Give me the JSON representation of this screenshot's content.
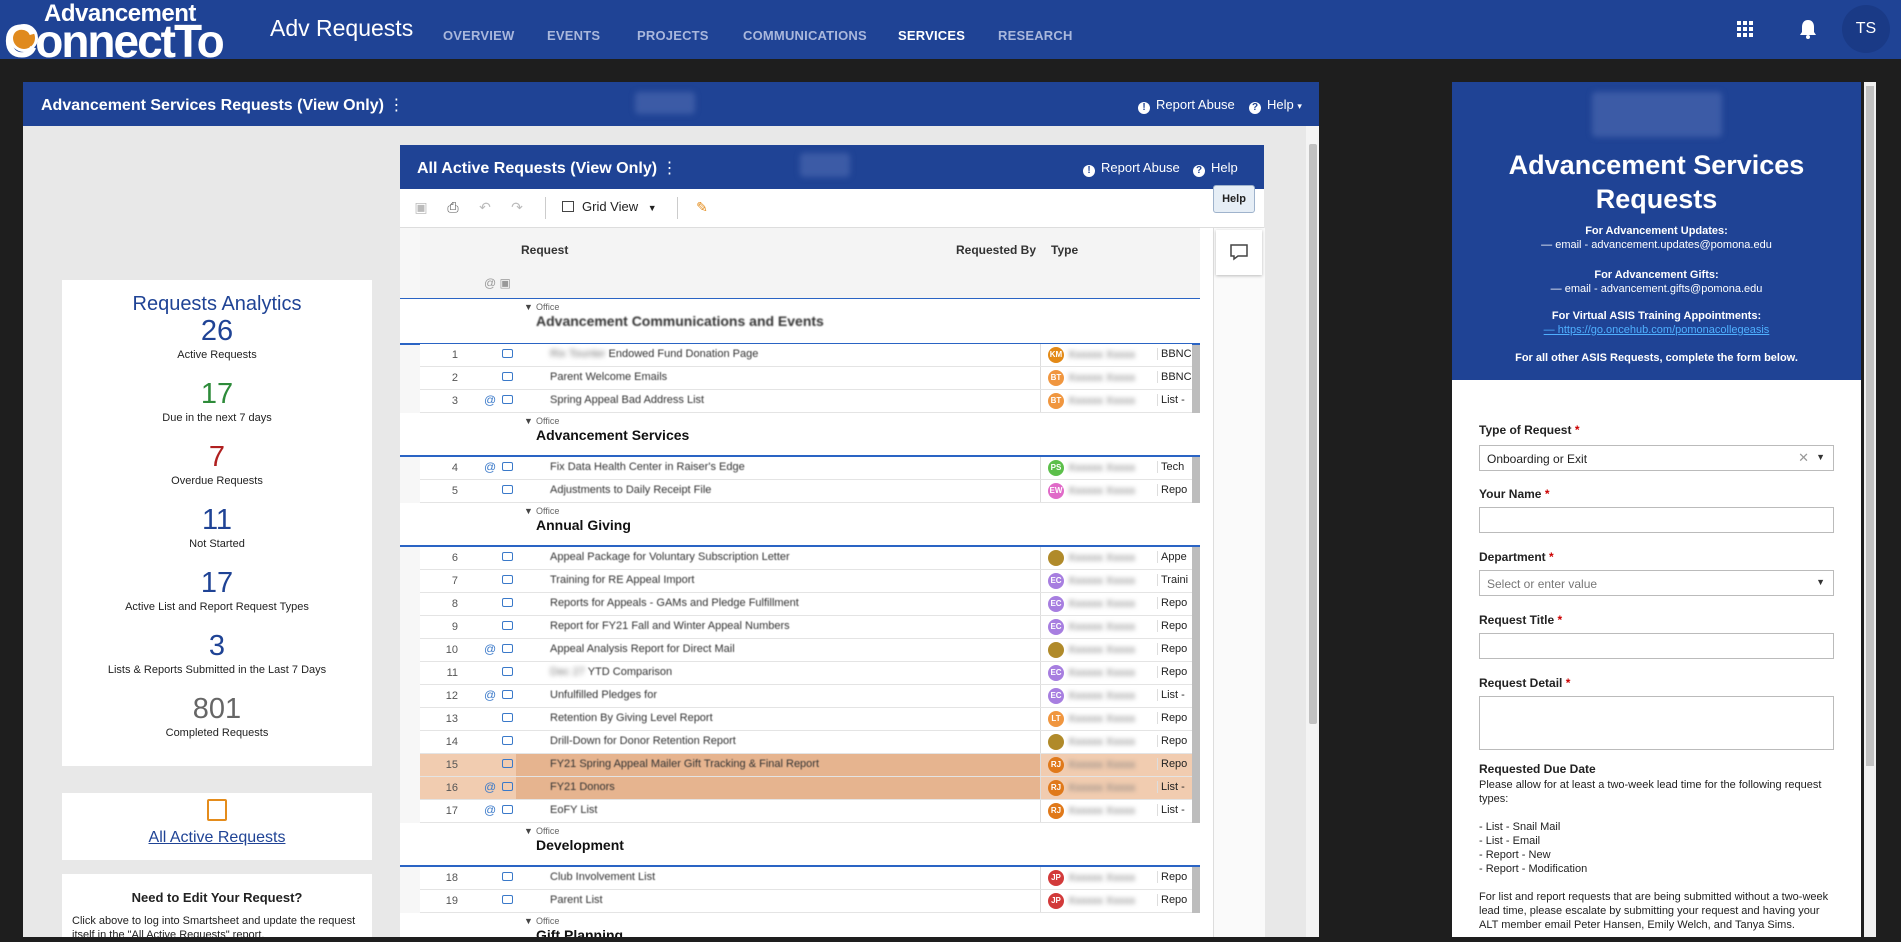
{
  "topbar": {
    "logo_line1": "Advancement",
    "logo_line2": "ConnectTo",
    "app_title": "Adv Requests",
    "nav": [
      "OVERVIEW",
      "EVENTS",
      "PROJECTS",
      "COMMUNICATIONS",
      "SERVICES",
      "RESEARCH"
    ],
    "active_nav": "SERVICES",
    "user_initials": "TS"
  },
  "left_panel": {
    "title": "Advancement Services Requests (View Only)",
    "report_abuse": "Report Abuse",
    "help": "Help"
  },
  "analytics": {
    "title": "Requests Analytics",
    "stats": [
      {
        "value": "26",
        "label": "Active Requests",
        "color": "#1f4395"
      },
      {
        "value": "17",
        "label": "Due in the next 7 days",
        "color": "#2e8b3a"
      },
      {
        "value": "7",
        "label": "Overdue Requests",
        "color": "#b02020"
      },
      {
        "value": "11",
        "label": "Not Started",
        "color": "#1f4395"
      },
      {
        "value": "17",
        "label": "Active List and Report Request Types",
        "color": "#1f4395"
      },
      {
        "value": "3",
        "label": "Lists & Reports Submitted in the Last 7 Days",
        "color": "#1f4395"
      },
      {
        "value": "801",
        "label": "Completed Requests",
        "color": "#666666"
      }
    ]
  },
  "all_active_link": "All Active Requests",
  "edit_card": {
    "title": "Need to Edit Your Request?",
    "text": "Click above to log into Smartsheet and update the request itself in the \"All Active Requests\" report."
  },
  "sheet": {
    "title": "All Active Requests (View Only)",
    "report_abuse": "Report Abuse",
    "help": "Help",
    "help_tooltip": "Help",
    "grid_view": "Grid View",
    "columns": {
      "request": "Request",
      "requested_by": "Requested By",
      "type": "Type"
    },
    "office_label": "Office",
    "groups": [
      {
        "name": "Advancement Communications and Events",
        "rows": [
          {
            "n": "1",
            "text": "Endowed Fund Donation Page",
            "blur_prefix": "Rix Tounter",
            "initials": "KM",
            "avcolor": "#e38a17",
            "type": "BBNC",
            "at": false
          },
          {
            "n": "2",
            "text": "Parent Welcome Emails",
            "blur_prefix": "",
            "initials": "BT",
            "avcolor": "#f0963f",
            "type": "BBNC",
            "at": false
          },
          {
            "n": "3",
            "text": "Spring Appeal Bad Address List",
            "blur_prefix": "",
            "initials": "BT",
            "avcolor": "#f0963f",
            "type": "List -",
            "at": true
          }
        ]
      },
      {
        "name": "Advancement Services",
        "rows": [
          {
            "n": "4",
            "text": "Fix Data Health Center in Raiser's Edge",
            "blur_prefix": "",
            "initials": "PS",
            "avcolor": "#5cbf4a",
            "type": "Tech",
            "at": true
          },
          {
            "n": "5",
            "text": "Adjustments to Daily Receipt File",
            "blur_prefix": "",
            "initials": "EW",
            "avcolor": "#e06ac8",
            "type": "Repo",
            "at": false
          }
        ]
      },
      {
        "name": "Annual Giving",
        "rows": [
          {
            "n": "6",
            "text": "Appeal Package for Voluntary Subscription Letter",
            "blur_prefix": "",
            "initials": "",
            "avcolor": "#b08a2a",
            "type": "Appe",
            "at": false
          },
          {
            "n": "7",
            "text": "Training for RE Appeal Import",
            "blur_prefix": "",
            "initials": "EC",
            "avcolor": "#a77ee0",
            "type": "Traini",
            "at": false
          },
          {
            "n": "8",
            "text": "Reports for Appeals - GAMs and Pledge Fulfillment",
            "blur_prefix": "",
            "initials": "EC",
            "avcolor": "#a77ee0",
            "type": "Repo",
            "at": false
          },
          {
            "n": "9",
            "text": "Report for FY21 Fall and Winter Appeal Numbers",
            "blur_prefix": "",
            "initials": "EC",
            "avcolor": "#a77ee0",
            "type": "Repo",
            "at": false
          },
          {
            "n": "10",
            "text": "Appeal Analysis Report for Direct Mail",
            "blur_prefix": "",
            "initials": "",
            "avcolor": "#b08a2a",
            "type": "Repo",
            "at": true
          },
          {
            "n": "11",
            "text": "YTD Comparison",
            "blur_prefix": "Dec 27",
            "initials": "EC",
            "avcolor": "#a77ee0",
            "type": "Repo",
            "at": false
          },
          {
            "n": "12",
            "text": "Unfulfilled Pledges for",
            "blur_prefix": "",
            "initials": "EC",
            "avcolor": "#a77ee0",
            "type": "List -",
            "at": true
          },
          {
            "n": "13",
            "text": "Retention By Giving Level Report",
            "blur_prefix": "",
            "initials": "LT",
            "avcolor": "#f0963f",
            "type": "Repo",
            "at": false
          },
          {
            "n": "14",
            "text": "Drill-Down for Donor Retention Report",
            "blur_prefix": "",
            "initials": "",
            "avcolor": "#b08a2a",
            "type": "Repo",
            "at": false
          },
          {
            "n": "15",
            "text": "FY21 Spring Appeal Mailer Gift Tracking & Final Report",
            "blur_prefix": "",
            "initials": "RJ",
            "avcolor": "#e0791a",
            "type": "Repo",
            "at": false,
            "hl": true
          },
          {
            "n": "16",
            "text": "FY21 Donors",
            "blur_prefix": "",
            "initials": "RJ",
            "avcolor": "#e0791a",
            "type": "List -",
            "at": true,
            "hl": true
          },
          {
            "n": "17",
            "text": "EoFY List",
            "blur_prefix": "",
            "initials": "RJ",
            "avcolor": "#e0791a",
            "type": "List -",
            "at": true
          }
        ]
      },
      {
        "name": "Development",
        "rows": [
          {
            "n": "18",
            "text": "Club Involvement List",
            "blur_prefix": "",
            "initials": "JP",
            "avcolor": "#d23a3a",
            "type": "Repo",
            "at": false
          },
          {
            "n": "19",
            "text": "Parent List",
            "blur_prefix": "",
            "initials": "JP",
            "avcolor": "#d23a3a",
            "type": "Repo",
            "at": false
          }
        ]
      },
      {
        "name": "Gift Planning",
        "rows": []
      }
    ]
  },
  "form": {
    "title": "Advancement Services Requests",
    "updates_heading": "For Advancement Updates:",
    "updates_email": "—   email - advancement.updates@pomona.edu",
    "gifts_heading": "For Advancement Gifts:",
    "gifts_email": "—   email - advancement.gifts@pomona.edu",
    "training_heading": "For Virtual ASIS Training Appointments:",
    "training_link": "—   https://go.oncehub.com/pomonacollegeasis",
    "other": "For all other ASIS Requests, complete the form below.",
    "type_label": "Type of Request",
    "type_value": "Onboarding or Exit",
    "name_label": "Your Name",
    "dept_label": "Department",
    "dept_placeholder": "Select or enter value",
    "title_label": "Request Title",
    "detail_label": "Request Detail",
    "due_label": "Requested Due Date",
    "due_intro": "Please allow for at least a two-week lead time for the following request types:",
    "due_types": [
      "- List - Snail Mail",
      "- List - Email",
      "- Report - New",
      "- Report - Modification"
    ],
    "due_note": "For list and report requests that are being submitted without a two-week lead time, please escalate by submitting your request and having your ALT member email Peter Hansen, Emily Welch, and Tanya Sims."
  }
}
